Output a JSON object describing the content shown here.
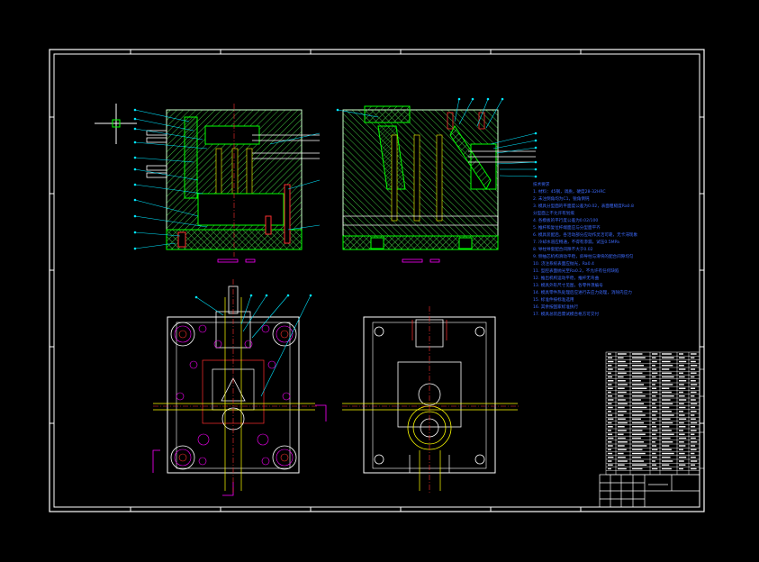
{
  "drawing": {
    "background": "#000000",
    "colors": {
      "frame": "#ffffff",
      "hatch": "#3fbf3f",
      "section_line": "#00ff00",
      "leader": "#00e5ff",
      "center": "#ff3030",
      "yellow": "#ffff00",
      "magenta": "#ff00ff",
      "text": "#3d6bff"
    },
    "icons": {
      "cursor": "crosshair-icon"
    },
    "tech_notes": {
      "lines": [
        "技术要求",
        "1. 材料：45钢，调质，硬度28-32HRC",
        "2. 未注倒角均为C1，锐角倒钝",
        "3. 模具分型面的平面度公差为0.02，表面粗糙度Ra0.8",
        "   分型面上不允许有划痕",
        "4. 各模板的平行度公差为0.02/100",
        "5. 推杆和复位杆端面应与分型面平齐",
        "6. 模具装配后，各活动部分应动作灵活可靠，无卡滞现象",
        "7. 冷却水道应畅通，不得有渗漏，试压0.5MPa",
        "8. 导柱导套配合间隙不大于0.02",
        "9. 侧抽芯机构滑动平稳，斜导柱与滑块的配合间隙均匀",
        "10. 浇注系统表面应抛光，Ra0.4",
        "11. 型腔表面抛光至Ra0.2，不允许有任何缺陷",
        "12. 推出机构运动平稳，推杆无弯曲",
        "13. 模具外形尺寸见图，各零件须编号",
        "14. 模具零件热处理后应进行去应力处理，消除内应力",
        "15. 标准件按标准选用",
        "16. 其余按国家标准执行",
        "17. 模具总装后需试模合格方可交付",
        "18. 未注公差尺寸按IT12级精度加工"
      ]
    },
    "section_labels": [
      "A-A",
      "B-B"
    ]
  }
}
